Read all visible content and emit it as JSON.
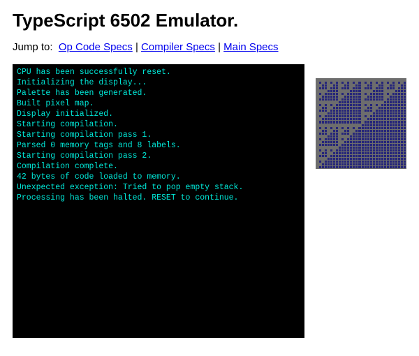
{
  "title": "TypeScript 6502 Emulator.",
  "jump": {
    "label": "Jump to:",
    "links": [
      "Op Code Specs",
      "Compiler Specs",
      "Main Specs"
    ],
    "separator": " | "
  },
  "console_lines": [
    "CPU has been successfully reset.",
    "Initializing the display...",
    "Palette has been generated.",
    "Built pixel map.",
    "Display initialized.",
    "Starting compilation.",
    "Starting compilation pass 1.",
    "Parsed 0 memory tags and 8 labels.",
    "Starting compilation pass 2.",
    "Compilation complete.",
    "42 bytes of code loaded to memory.",
    "Unexpected exception: Tried to pop empty stack.",
    "Processing has been halted. RESET to continue."
  ],
  "display": {
    "width": 32,
    "height": 32,
    "on_color": "#6d6d6d",
    "off_color": "#25257a"
  }
}
